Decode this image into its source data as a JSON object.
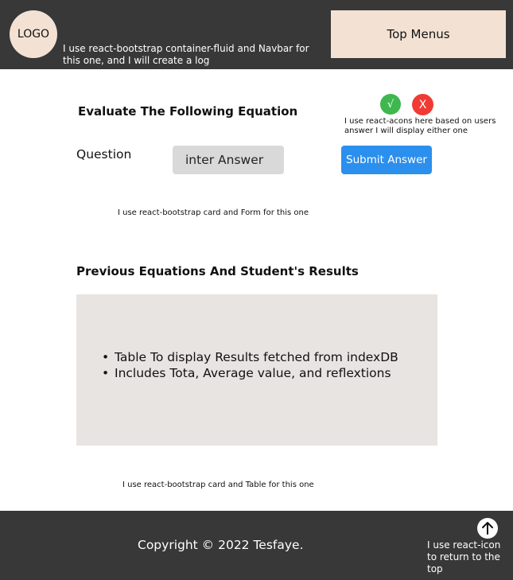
{
  "navbar": {
    "logo": "LOGO",
    "note": "I use react-bootstrap container-fluid and Navbar for this one, and I will create a log",
    "top_menus": "Top Menus"
  },
  "evaluate": {
    "title": "Evaluate The Following Equation",
    "question_label": "Question",
    "answer_placeholder": "inter Answer",
    "submit_label": "Submit Answer",
    "correct_icon": "√",
    "wrong_icon": "X",
    "icons_note": "I use react-acons here based on users answer I will display either one",
    "card_note": "I use react-bootstrap card and Form for this one"
  },
  "results": {
    "title": "Previous Equations And Student's Results",
    "items": [
      "Table To display Results fetched from indexDB",
      "Includes Tota, Average value, and reflextions"
    ],
    "card_note": "I use react-bootstrap card and Table for this one"
  },
  "footer": {
    "copyright": "Copyright © 2022 Tesfaye.",
    "back_to_top_icon": "arrow-up-circle-icon",
    "note": "I use react-icon to return to the top"
  },
  "colors": {
    "navbar_bg": "#383838",
    "accent_peach": "#f3e2d4",
    "submit_blue": "#2b8fee",
    "correct_green": "#3fb74f",
    "wrong_red": "#ef3b34",
    "table_bg": "#e8e4e2",
    "input_bg": "#d9d9d9"
  }
}
